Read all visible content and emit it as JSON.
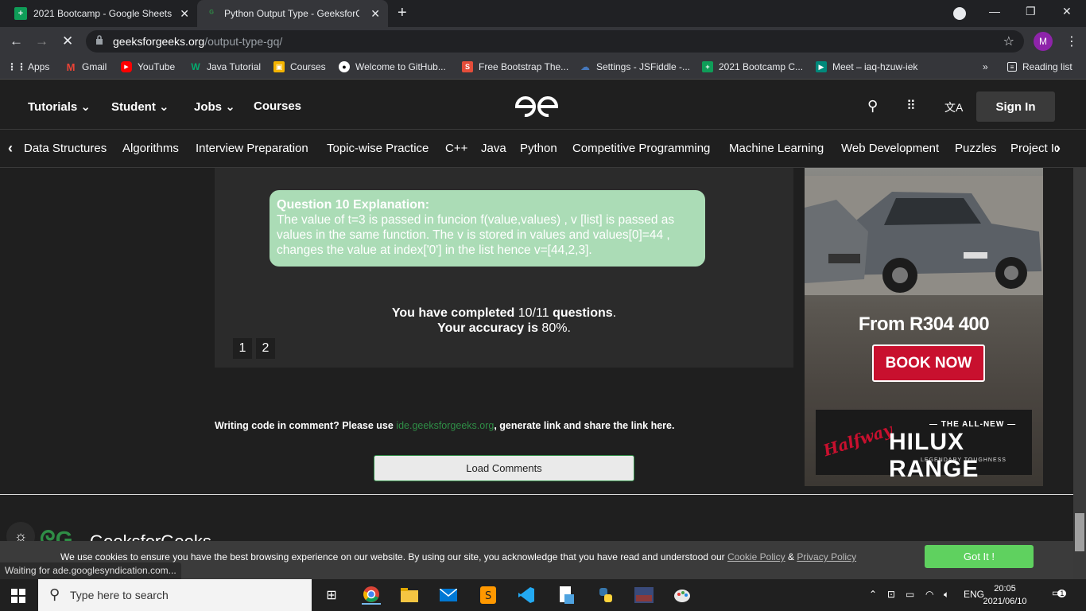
{
  "tabs": [
    {
      "title": "2021 Bootcamp - Google Sheets",
      "icon": "sheets-icon"
    },
    {
      "title": "Python Output Type - GeeksforG",
      "icon": "gfg-icon"
    }
  ],
  "address": {
    "domain": "geeksforgeeks.org",
    "path": "/output-type-gq/"
  },
  "profile_initial": "M",
  "bookmarks": [
    {
      "label": "Apps",
      "icon": "apps-icon",
      "color": "#4285f4"
    },
    {
      "label": "Gmail",
      "icon": "gmail-icon",
      "color": "#ea4335"
    },
    {
      "label": "YouTube",
      "icon": "youtube-icon",
      "color": "#ff0000"
    },
    {
      "label": "Java Tutorial",
      "icon": "w3-icon",
      "color": "#04aa6d"
    },
    {
      "label": "Courses",
      "icon": "courses-icon",
      "color": "#f4b400"
    },
    {
      "label": "Welcome to GitHub...",
      "icon": "github-icon",
      "color": "#ffffff"
    },
    {
      "label": "Free Bootstrap The...",
      "icon": "s-icon",
      "color": "#e44d3a"
    },
    {
      "label": "Settings - JSFiddle -...",
      "icon": "jsfiddle-icon",
      "color": "#4679bd"
    },
    {
      "label": "2021 Bootcamp C...",
      "icon": "sheets-icon",
      "color": "#0f9d58"
    },
    {
      "label": "Meet – iaq-hzuw-iek",
      "icon": "meet-icon",
      "color": "#00897b"
    }
  ],
  "reading_list": "Reading list",
  "header": {
    "nav": [
      "Tutorials",
      "Student",
      "Jobs",
      "Courses"
    ],
    "sign_in": "Sign In"
  },
  "subnav": [
    "Data Structures",
    "Algorithms",
    "Interview Preparation",
    "Topic-wise Practice",
    "C++",
    "Java",
    "Python",
    "Competitive Programming",
    "Machine Learning",
    "Web Development",
    "Puzzles",
    "Project Id"
  ],
  "explanation": {
    "title": "Question 10 Explanation:",
    "body": "The value of t=3 is passed in funcion f(value,values) , v [list] is passed as values in the same function. The v is stored in values and values[0]=44 , changes the value at index['0'] in the list hence v=[44,2,3]."
  },
  "result": {
    "completed_prefix": "You have completed",
    "completed_value": "10/11",
    "completed_suffix": "questions",
    "accuracy_prefix": "Your accuracy is",
    "accuracy_value": "80%"
  },
  "pages": [
    "1",
    "2"
  ],
  "comment": {
    "prefix": "Writing code in comment? Please use",
    "link": "ide.geeksforgeeks.org",
    "suffix": ", generate link and share the link here."
  },
  "load_comments": "Load Comments",
  "ad": {
    "price": "From R304 400",
    "cta": "BOOK NOW",
    "dealer": "Halfway",
    "tagline_top": "— THE ALL-NEW —",
    "model": "HILUX RANGE",
    "tagline_bottom": "LEGENDARY TOUGHNESS",
    "badge": "HILUX"
  },
  "footer": {
    "brand": "GeeksforGeeks"
  },
  "cookie": {
    "text": "We use cookies to ensure you have the best browsing experience on our website. By using our site, you acknowledge that you have read and understood our",
    "policy1": "Cookie Policy",
    "amp": "&",
    "policy2": "Privacy Policy",
    "button": "Got It !"
  },
  "status": "Waiting for ade.googlesyndication.com...",
  "taskbar": {
    "search_placeholder": "Type here to search",
    "lang": "ENG",
    "time": "20:05",
    "date": "2021/06/10",
    "notif_count": "1"
  }
}
